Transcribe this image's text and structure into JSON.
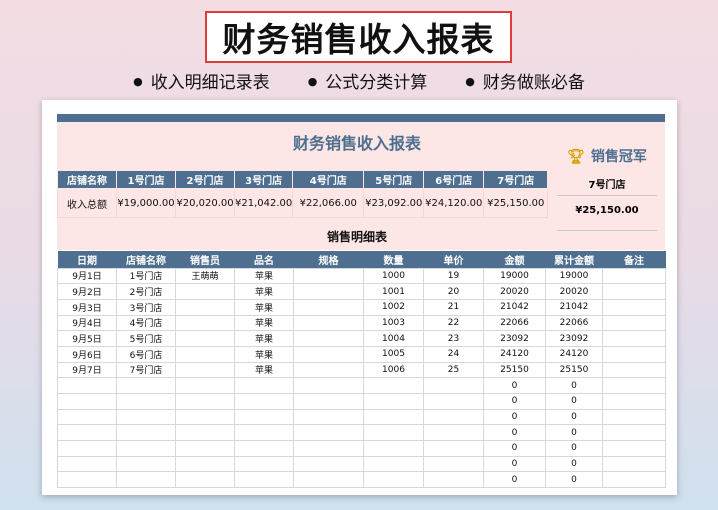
{
  "banner": {
    "title": "财务销售收入报表",
    "bullets": [
      "收入明细记录表",
      "公式分类计算",
      "财务做账必备"
    ]
  },
  "sheet": {
    "title": "财务销售收入报表",
    "detail_title": "销售明细表",
    "summary": {
      "header": [
        "店铺名称",
        "1号门店",
        "2号门店",
        "3号门店",
        "4号门店",
        "5号门店",
        "6号门店",
        "7号门店"
      ],
      "row": [
        "收入总额",
        "¥19,000.00",
        "¥20,020.00",
        "¥21,042.00",
        "¥22,066.00",
        "¥23,092.00",
        "¥24,120.00",
        "¥25,150.00"
      ]
    },
    "champion": {
      "label": "销售冠军",
      "store": "7号门店",
      "amount": "¥25,150.00"
    },
    "columns": [
      "日期",
      "店铺名称",
      "销售员",
      "品名",
      "规格",
      "数量",
      "单价",
      "金额",
      "累计金额",
      "备注"
    ],
    "rows": [
      [
        "9月1日",
        "1号门店",
        "王萌萌",
        "苹果",
        "",
        "1000",
        "19",
        "19000",
        "19000",
        ""
      ],
      [
        "9月2日",
        "2号门店",
        "",
        "苹果",
        "",
        "1001",
        "20",
        "20020",
        "20020",
        ""
      ],
      [
        "9月3日",
        "3号门店",
        "",
        "苹果",
        "",
        "1002",
        "21",
        "21042",
        "21042",
        ""
      ],
      [
        "9月4日",
        "4号门店",
        "",
        "苹果",
        "",
        "1003",
        "22",
        "22066",
        "22066",
        ""
      ],
      [
        "9月5日",
        "5号门店",
        "",
        "苹果",
        "",
        "1004",
        "23",
        "23092",
        "23092",
        ""
      ],
      [
        "9月6日",
        "6号门店",
        "",
        "苹果",
        "",
        "1005",
        "24",
        "24120",
        "24120",
        ""
      ],
      [
        "9月7日",
        "7号门店",
        "",
        "苹果",
        "",
        "1006",
        "25",
        "25150",
        "25150",
        ""
      ],
      [
        "",
        "",
        "",
        "",
        "",
        "",
        "",
        "0",
        "0",
        ""
      ],
      [
        "",
        "",
        "",
        "",
        "",
        "",
        "",
        "0",
        "0",
        ""
      ],
      [
        "",
        "",
        "",
        "",
        "",
        "",
        "",
        "0",
        "0",
        ""
      ],
      [
        "",
        "",
        "",
        "",
        "",
        "",
        "",
        "0",
        "0",
        ""
      ],
      [
        "",
        "",
        "",
        "",
        "",
        "",
        "",
        "0",
        "0",
        ""
      ],
      [
        "",
        "",
        "",
        "",
        "",
        "",
        "",
        "0",
        "0",
        ""
      ],
      [
        "",
        "",
        "",
        "",
        "",
        "",
        "",
        "0",
        "0",
        ""
      ]
    ]
  }
}
